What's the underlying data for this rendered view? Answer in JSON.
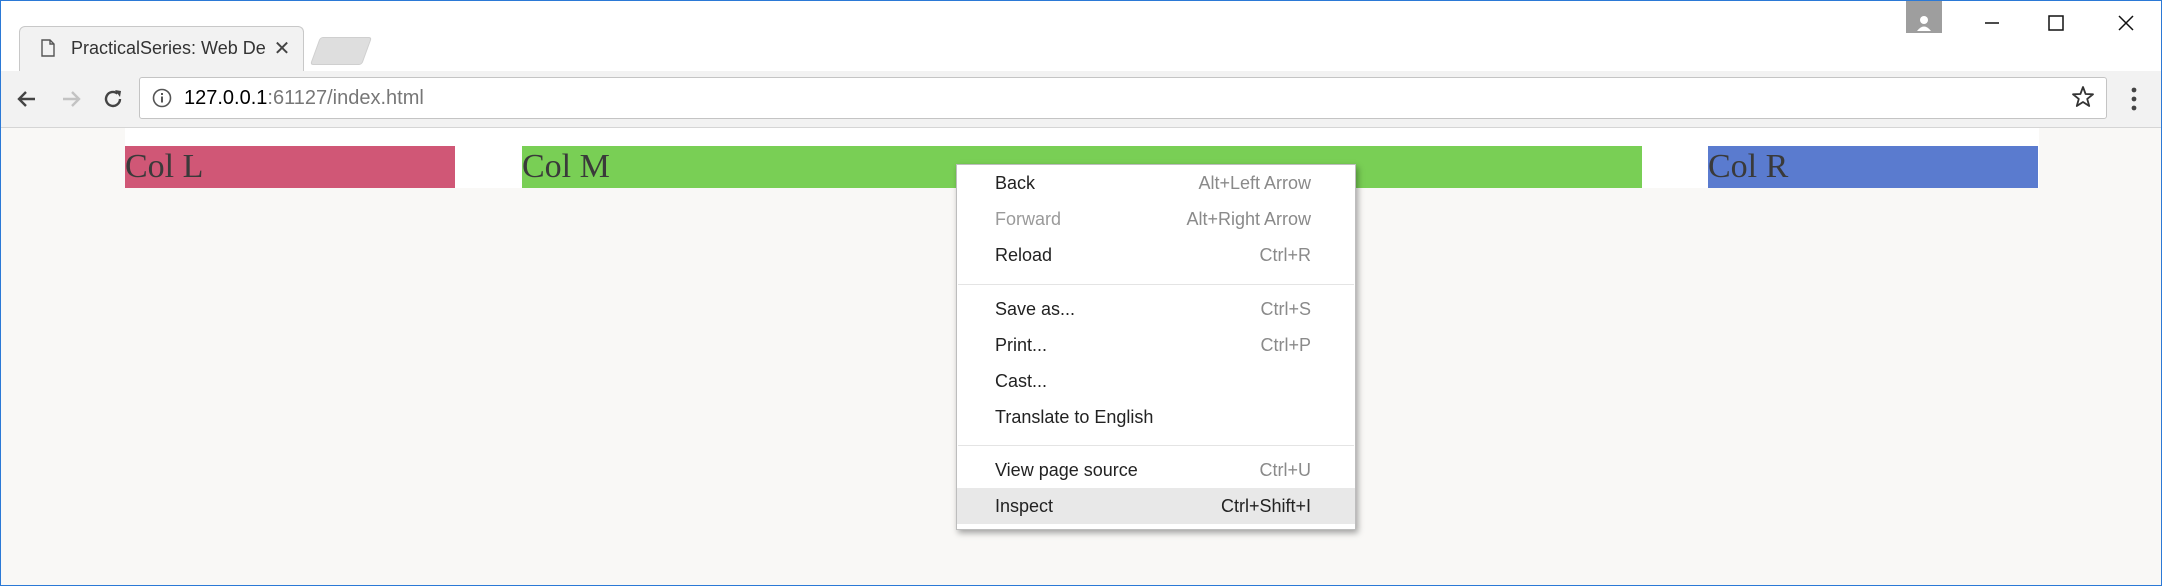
{
  "browser": {
    "tab": {
      "title": "PracticalSeries: Web Deve",
      "close_glyph": "✕"
    },
    "address": {
      "host": "127.0.0.1",
      "port": ":61127",
      "path": "/index.html"
    }
  },
  "page": {
    "columns": [
      {
        "label": "Col L",
        "color": "#d05776"
      },
      {
        "label": "Col M",
        "color": "#79cf55"
      },
      {
        "label": "Col R",
        "color": "#5a7bcf"
      }
    ]
  },
  "context_menu": {
    "items": [
      {
        "label": "Back",
        "shortcut": "Alt+Left Arrow",
        "enabled": true
      },
      {
        "label": "Forward",
        "shortcut": "Alt+Right Arrow",
        "enabled": false
      },
      {
        "label": "Reload",
        "shortcut": "Ctrl+R",
        "enabled": true
      },
      {
        "label": "Save as...",
        "shortcut": "Ctrl+S",
        "enabled": true
      },
      {
        "label": "Print...",
        "shortcut": "Ctrl+P",
        "enabled": true
      },
      {
        "label": "Cast...",
        "shortcut": "",
        "enabled": true
      },
      {
        "label": "Translate to English",
        "shortcut": "",
        "enabled": true
      },
      {
        "label": "View page source",
        "shortcut": "Ctrl+U",
        "enabled": true
      },
      {
        "label": "Inspect",
        "shortcut": "Ctrl+Shift+I",
        "enabled": true,
        "highlighted": true
      }
    ]
  },
  "icons": {
    "tab": "page-icon",
    "back": "arrow-left-icon",
    "forward": "arrow-right-icon",
    "reload": "reload-icon",
    "info": "info-icon",
    "bookmark": "star-icon",
    "menu": "kebab-menu-icon",
    "profile": "profile-icon",
    "minimize": "minimize-icon",
    "maximize": "maximize-icon",
    "close": "close-icon"
  }
}
